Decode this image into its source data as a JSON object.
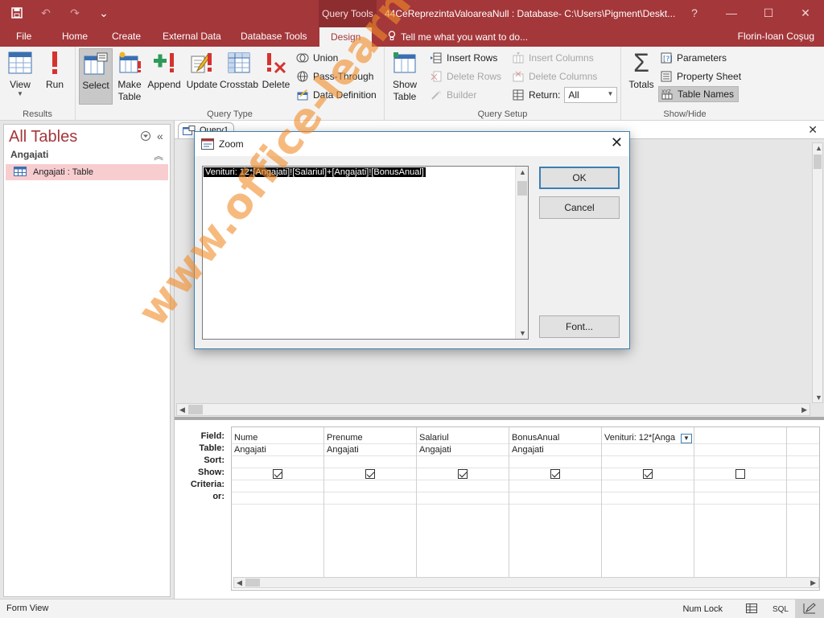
{
  "titlebar": {
    "context_tab": "Query Tools",
    "doc_title": "44CeReprezintaValoareaNull : Database- C:\\Users\\Pigment\\Deskt...",
    "help": "?",
    "minimize": "—",
    "restore": "☐",
    "close": "✕"
  },
  "tabs": {
    "file": "File",
    "home": "Home",
    "create": "Create",
    "external": "External Data",
    "dbtools": "Database Tools",
    "design": "Design",
    "tellme": "Tell me what you want to do...",
    "user": "Florin-Ioan Coşug"
  },
  "ribbon": {
    "results": {
      "label": "Results",
      "view": "View",
      "run": "Run"
    },
    "query_type": {
      "label": "Query Type",
      "select": "Select",
      "make_table_1": "Make",
      "make_table_2": "Table",
      "append": "Append",
      "update": "Update",
      "crosstab": "Crosstab",
      "delete": "Delete",
      "union": "Union",
      "pass_through": "Pass-Through",
      "data_definition": "Data Definition"
    },
    "query_setup": {
      "label": "Query Setup",
      "show_table_1": "Show",
      "show_table_2": "Table",
      "insert_rows": "Insert Rows",
      "delete_rows": "Delete Rows",
      "builder": "Builder",
      "insert_columns": "Insert Columns",
      "delete_columns": "Delete Columns",
      "return_label": "Return:",
      "return_value": "All"
    },
    "show_hide": {
      "label": "Show/Hide",
      "totals": "Totals",
      "parameters": "Parameters",
      "property_sheet": "Property Sheet",
      "table_names": "Table Names"
    }
  },
  "nav": {
    "title": "All Tables",
    "group": "Angajati",
    "item": "Angajati : Table"
  },
  "document": {
    "tab": "Query1"
  },
  "qbe": {
    "row_labels": [
      "Field:",
      "Table:",
      "Sort:",
      "Show:",
      "Criteria:",
      "or:"
    ],
    "columns": [
      {
        "field": "Nume",
        "table": "Angajati",
        "show": true
      },
      {
        "field": "Prenume",
        "table": "Angajati",
        "show": true
      },
      {
        "field": "Salariul",
        "table": "Angajati",
        "show": true
      },
      {
        "field": "BonusAnual",
        "table": "Angajati",
        "show": true
      },
      {
        "field": "Venituri: 12*[Anga",
        "table": "",
        "show": true
      },
      {
        "field": "",
        "table": "",
        "show": false
      },
      {
        "field": "",
        "table": "",
        "show": null
      }
    ]
  },
  "dialog": {
    "title": "Zoom",
    "expression": "Venituri: 12*[Angajati]![Salariul]+[Angajati]![BonusAnual]",
    "ok": "OK",
    "cancel": "Cancel",
    "font": "Font..."
  },
  "status": {
    "left": "Form View",
    "numlock": "Num Lock",
    "sql": "SQL"
  },
  "watermark": "www.office-learning.ro",
  "colors": {
    "accent": "#a4373a",
    "selection_bg": "#f8cdd0",
    "dialog_border": "#3c7fb1",
    "watermark": "#f28c28"
  }
}
